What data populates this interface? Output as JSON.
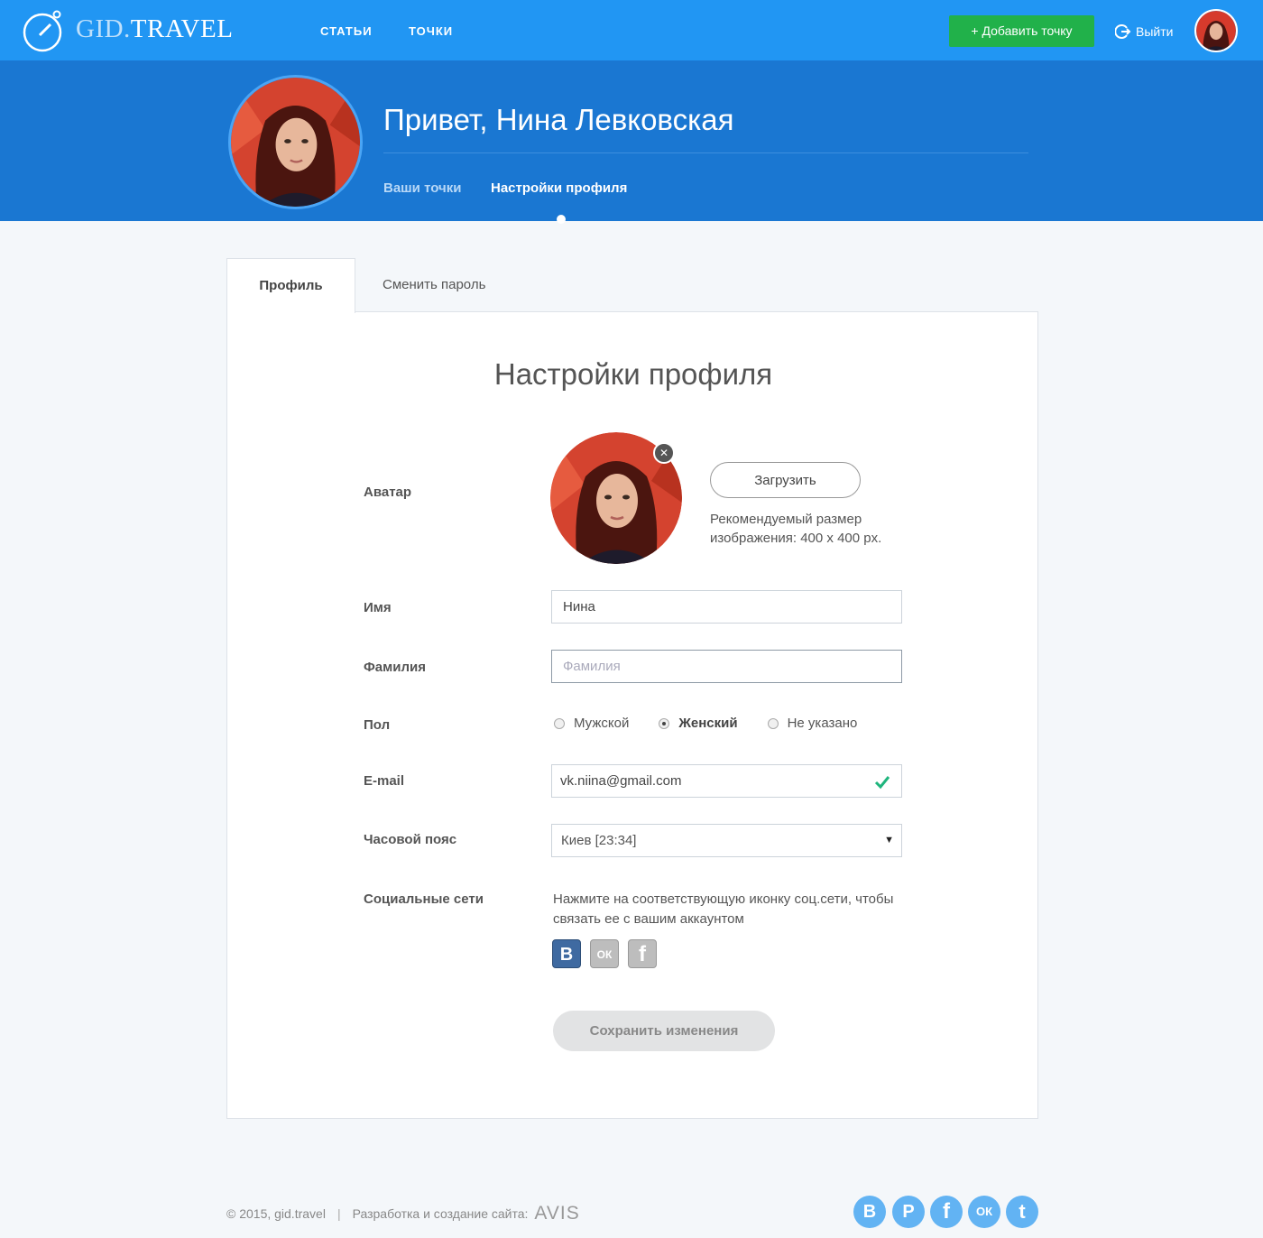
{
  "header": {
    "logo_gid": "GID.",
    "logo_travel": "TRAVEL",
    "nav": {
      "articles": "СТАТЬИ",
      "points": "ТОЧКИ"
    },
    "add_point_label": "+ Добавить точку",
    "logout_label": "Выйти"
  },
  "profile": {
    "greeting": "Привет, Нина Левковская",
    "tabs": {
      "your_points": "Ваши точки",
      "settings": "Настройки профиля"
    }
  },
  "card_tabs": {
    "profile": "Профиль",
    "change_password": "Сменить пароль"
  },
  "form": {
    "title": "Настройки профиля",
    "avatar": {
      "label": "Аватар",
      "upload_label": "Загрузить",
      "hint": "Рекомендуемый размер изображения: 400 x 400 px.",
      "remove_glyph": "✕"
    },
    "first_name": {
      "label": "Имя",
      "value": "Нина"
    },
    "last_name": {
      "label": "Фамилия",
      "value": "",
      "placeholder": "Фамилия"
    },
    "gender": {
      "label": "Пол",
      "options": [
        "Мужской",
        "Женский",
        "Не указано"
      ],
      "selected": "Женский"
    },
    "email": {
      "label": "E-mail",
      "value": "vk.niina@gmail.com"
    },
    "timezone": {
      "label": "Часовой пояс",
      "value": "Киев [23:34]",
      "arrow": "▼"
    },
    "social": {
      "label": "Социальные сети",
      "hint": "Нажмите на соответствующую иконку соц.сети, чтобы связать ее с вашим аккаунтом",
      "icons": {
        "vk": "В",
        "ok": "ОК",
        "fb": "f"
      }
    },
    "save_label": "Сохранить изменения"
  },
  "footer": {
    "copyright": "© 2015, gid.travel",
    "separator": "|",
    "dev_text": "Разработка и создание сайта:",
    "dev_brand": "AVIS",
    "social": {
      "vk": "В",
      "pinterest": "P",
      "facebook": "f",
      "ok": "ОК",
      "twitter": "t"
    }
  },
  "colors": {
    "topbar": "#2196f3",
    "profile_header": "#1a77d2",
    "add_button": "#21b14a",
    "email_valid": "#1fb57d",
    "vk": "#3f6aa1",
    "footer_social": "#62b3f3"
  }
}
